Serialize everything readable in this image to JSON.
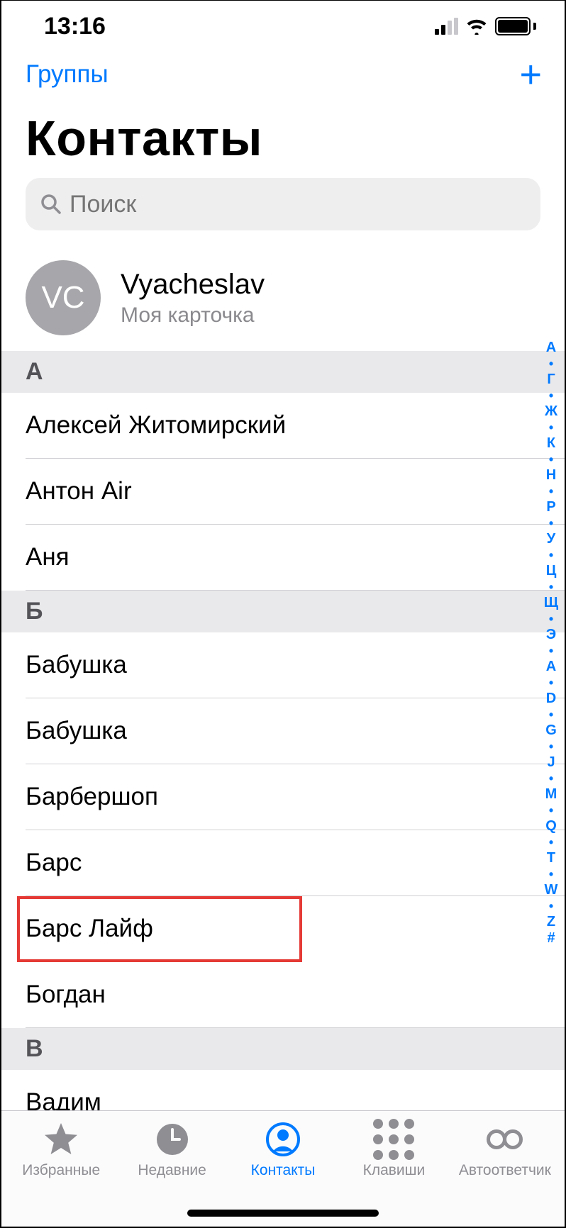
{
  "status": {
    "time": "13:16"
  },
  "nav": {
    "groups": "Группы"
  },
  "title": "Контакты",
  "search": {
    "placeholder": "Поиск"
  },
  "myCard": {
    "initials": "VC",
    "name": "Vyacheslav",
    "sub": "Моя карточка"
  },
  "sections": {
    "A": {
      "header": "А",
      "rows": [
        "Алексей Житомирский",
        "Антон Air",
        "Аня"
      ]
    },
    "B": {
      "header": "Б",
      "rows": [
        "Бабушка",
        "Бабушка",
        "Барбершоп",
        "Барс",
        "Барс Лайф",
        "Богдан"
      ]
    },
    "V": {
      "header": "В",
      "rows": [
        "Вадим"
      ]
    }
  },
  "index": [
    "А",
    "•",
    "Г",
    "•",
    "Ж",
    "•",
    "К",
    "•",
    "Н",
    "•",
    "Р",
    "•",
    "У",
    "•",
    "Ц",
    "•",
    "Щ",
    "•",
    "Э",
    "•",
    "A",
    "•",
    "D",
    "•",
    "G",
    "•",
    "J",
    "•",
    "M",
    "•",
    "Q",
    "•",
    "T",
    "•",
    "W",
    "•",
    "Z",
    "#"
  ],
  "tabs": {
    "favorites": "Избранные",
    "recents": "Недавние",
    "contacts": "Контакты",
    "keypad": "Клавиши",
    "voicemail": "Автоответчик"
  }
}
